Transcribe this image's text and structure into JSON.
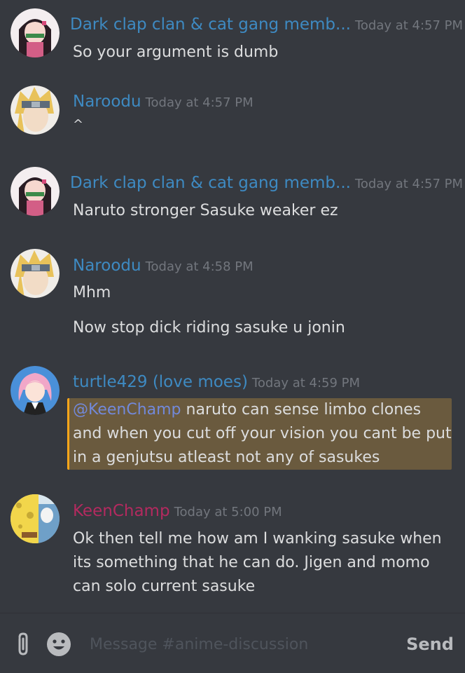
{
  "colors": {
    "background": "#36393f",
    "message_text": "#dcddde",
    "timestamp": "#72767d",
    "mention": "#7289da",
    "highlight_bg": "#6a5a3e",
    "highlight_bar": "#faa61a",
    "placeholder": "#4f545c"
  },
  "messages": [
    {
      "avatar_icon": "anime-girl-avatar-icon",
      "username": "Dark clap clan & cat gang memb...",
      "username_color": "#3e8ac2",
      "timestamp": "Today at 4:57 PM",
      "lines": [
        "So your argument is dumb"
      ]
    },
    {
      "avatar_icon": "anime-ninja-avatar-icon",
      "username": "Naroodu",
      "username_color": "#3e8ac2",
      "timestamp": "Today at 4:57 PM",
      "lines": [
        "^"
      ]
    },
    {
      "avatar_icon": "anime-girl-avatar-icon",
      "username": "Dark clap clan & cat gang memb...",
      "username_color": "#3e8ac2",
      "timestamp": "Today at 4:57 PM",
      "lines": [
        "Naruto stronger Sasuke weaker ez"
      ]
    },
    {
      "avatar_icon": "anime-ninja-avatar-icon",
      "username": "Naroodu",
      "username_color": "#3e8ac2",
      "timestamp": "Today at 4:58 PM",
      "lines": [
        "Mhm",
        "Now stop dick riding sasuke u jonin"
      ]
    },
    {
      "avatar_icon": "pink-hair-avatar-icon",
      "username": "turtle429 (love moes)",
      "username_color": "#3e8ac2",
      "timestamp": "Today at 4:59 PM",
      "mention": "@KeenChamp",
      "lines": [
        " naruto can sense limbo clones",
        "and when you cut off your vision you cant be put",
        "in a genjutsu atleast not any of sasukes"
      ]
    },
    {
      "avatar_icon": "sponge-avatar-icon",
      "username": "KeenChamp",
      "username_color": "#b32a5f",
      "timestamp": "Today at 5:00 PM",
      "lines": [
        "Ok then tell me how am I wanking sasuke when",
        "its something that he can do. Jigen and momo",
        "can solo current sasuke"
      ]
    }
  ],
  "composer": {
    "attach_icon": "paperclip-icon",
    "emoji_icon": "emoji-icon",
    "placeholder": "Message #anime-discussion",
    "value": "",
    "send_label": "Send"
  }
}
